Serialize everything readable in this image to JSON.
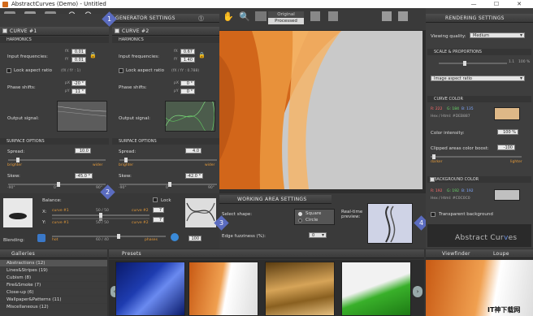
{
  "window": {
    "title": "AbstractCurves (Demo) - Untitled",
    "minimize": "—",
    "maximize": "☐",
    "close": "✕"
  },
  "badges": [
    "1",
    "2",
    "3",
    "4"
  ],
  "generator": {
    "title": "GENERATOR SETTINGS"
  },
  "curve1": {
    "title": "CURVE #1",
    "harmonics": "HARMONICS",
    "input_freq": "Input frequencies:",
    "fx_label": "fX",
    "fy_label": "fY",
    "fx": "0.01",
    "fy": "0.01",
    "lock_ratio": "Lock aspect ratio",
    "ratio_note": "(fX / fY : 1)",
    "phase_shifts": "Phase shifts:",
    "px_label": "pX",
    "py_label": "pY",
    "px": "-20 °",
    "py": "11 °",
    "output_signal": "Output signal:"
  },
  "curve2": {
    "title": "CURVE #2",
    "harmonics": "HARMONICS",
    "input_freq": "Input frequencies:",
    "fx_label": "fX",
    "fy_label": "fY",
    "fx": "0.67",
    "fy": "1.40",
    "lock_ratio": "Lock aspect ratio",
    "ratio_note": "(fX / fY : 0.788)",
    "phase_shifts": "Phase shifts:",
    "px_label": "pX",
    "py_label": "pY",
    "px": "0 °",
    "py": "0 °",
    "output_signal": "Output signal:"
  },
  "surface1": {
    "title": "SURFACE OPTIONS",
    "spread": "Spread:",
    "spread_val": "10.0",
    "brighter": "brighter",
    "wider": "wider",
    "skew": "Skew:",
    "skew_val": "-45.0 °",
    "ticks": [
      "-90°",
      "0°",
      "90°"
    ]
  },
  "surface2": {
    "title": "SURFACE OPTIONS",
    "spread": "Spread:",
    "spread_val": "4.0",
    "brighter": "brighter",
    "wider": "wider",
    "skew": "Skew:",
    "skew_val": "-42.0 °",
    "ticks": [
      "-90°",
      "0°",
      "90°"
    ]
  },
  "balance": {
    "title": "Balance:",
    "lock": "Lock",
    "x_label": "X:",
    "y_label": "Y:",
    "x_left": "curve #1",
    "x_mid": "50 / 50",
    "x_right": "curve #2",
    "x_val": "7",
    "y_left": "curve #1",
    "y_mid": "50 / 50",
    "y_right": "curve #2",
    "y_val": "7",
    "blending": "Blending:",
    "blend_left": "hot",
    "blend_mid": "60 / 40",
    "blend_right": "phases",
    "blend_val": "100"
  },
  "view_tabs": {
    "original": "Original",
    "processed": "Processed"
  },
  "working_area": {
    "title": "WORKING AREA SETTINGS",
    "select_shape": "Select shape:",
    "square": "Square",
    "circle": "Circle",
    "realtime": "Real-time preview:",
    "edge_fuzz": "Edge fuzziness (%):",
    "edge_val": "0"
  },
  "rendering": {
    "title": "RENDERING SETTINGS",
    "viewing_quality": "Viewing quality:",
    "quality_val": "Medium",
    "scale_title": "SCALE & PROPORTIONS",
    "scale_val": "1.1",
    "scale_pct": "100 %",
    "image_aspect": "Image aspect ratio",
    "curve_color": "CURVE COLOR",
    "r": "R: 222",
    "g": "G: 184",
    "b": "B: 135",
    "hex": "Hex / Html: #DEB887",
    "color_intensity": "Color intensity:",
    "intensity_val": "100 %",
    "clipped_boost": "Clipped areas color boost:",
    "boost_val": "-100",
    "darker": "darker",
    "lighter": "lighter",
    "bg_color": "BACKGROUND COLOR",
    "bg_r": "R: 192",
    "bg_g": "G: 192",
    "bg_b": "B: 192",
    "bg_hex": "Hex / Html: #C0C0C0",
    "transparent_bg": "Transparent background",
    "brand_left": "Abstract Cur",
    "brand_right": "es",
    "brand_mid": "v"
  },
  "galleries": {
    "title": "Galleries",
    "items": [
      "Abstractions (12)",
      "Lines&Stripes (19)",
      "Cubism (8)",
      "Fire&Smoke (7)",
      "Close-up (6)",
      "Wallpaper&Patterns (11)",
      "Miscellaneous (12)"
    ]
  },
  "presets": {
    "title": "Presets"
  },
  "viewfinder": {
    "title": "Viewfinder",
    "loupe": "Loupe"
  },
  "watermark": "IT神下载网",
  "colors": {
    "curve_color": "#DEB887",
    "bg_color": "#C0C0C0",
    "accent": "#5b6cc0"
  }
}
